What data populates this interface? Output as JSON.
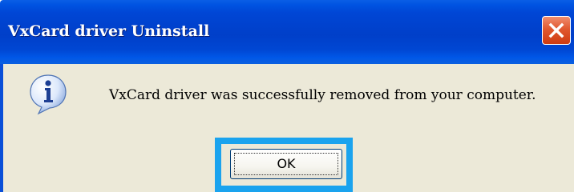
{
  "dialog": {
    "title": "VxCard driver Uninstall",
    "message": "VxCard driver was successfully removed from your computer.",
    "icon": "info-icon",
    "buttons": {
      "ok_label": "OK"
    }
  },
  "title_bar": {
    "close_icon": "close-icon"
  },
  "colors": {
    "title_bar": "#0046d5",
    "dialog_background": "#ece9d8",
    "close_button": "#e0582f",
    "highlight_box": "#1aa3ee"
  }
}
